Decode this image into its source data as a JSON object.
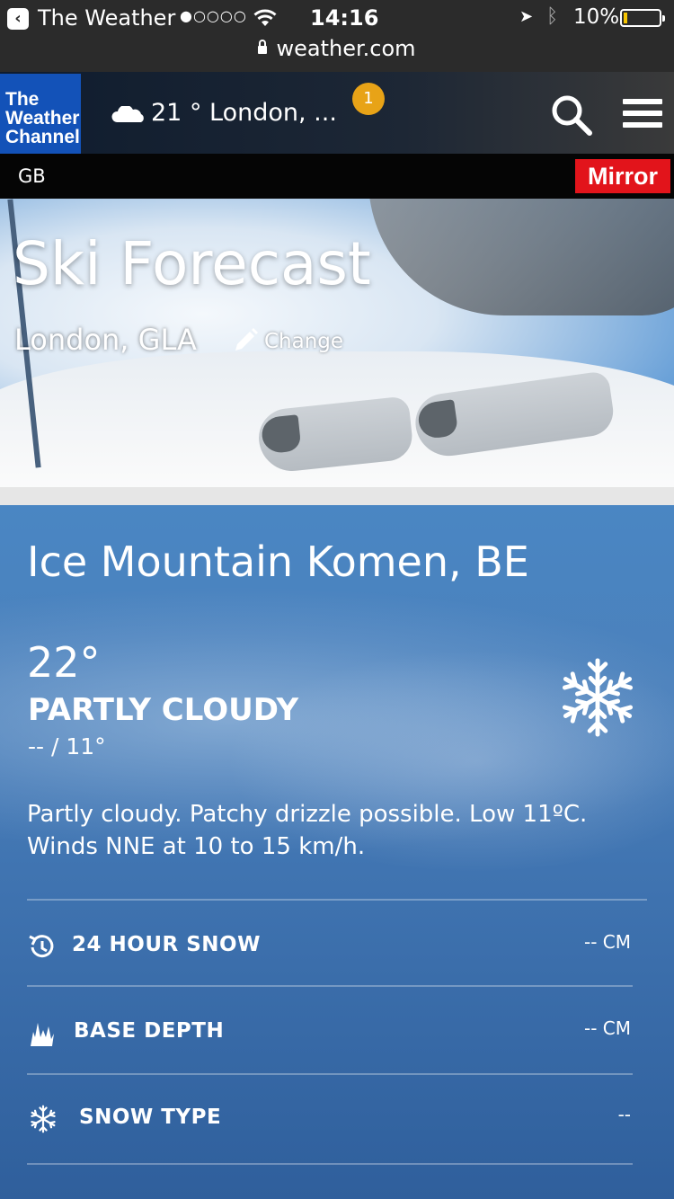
{
  "status_bar": {
    "back_app": "The Weather",
    "signal": "●○○○○",
    "time": "14:16",
    "battery": "10%",
    "url": "weather.com"
  },
  "header": {
    "logo_lines": [
      "The",
      "Weather",
      "Channel"
    ],
    "current_temp_location": "21 ° London, ...",
    "notification_count": "1",
    "icons": [
      "cloud-icon",
      "search-icon",
      "menu-icon"
    ]
  },
  "subbar": {
    "region": "GB",
    "partner": "Mirror"
  },
  "hero": {
    "title": "Ski Forecast",
    "location": "London, GLA",
    "change_label": "Change"
  },
  "resort": {
    "name": "Ice Mountain Komen, BE",
    "temperature": "22°",
    "condition": "PARTLY CLOUDY",
    "hi_lo": "-- / 11°",
    "description": "Partly cloudy. Patchy drizzle possible. Low 11ºC. Winds NNE at 10 to 15 km/h.",
    "stats": [
      {
        "icon": "history-icon",
        "label": "24 HOUR SNOW",
        "value": "-- CM"
      },
      {
        "icon": "mountain-icon",
        "label": "BASE DEPTH",
        "value": "-- CM"
      },
      {
        "icon": "snowflake-icon",
        "label": "SNOW TYPE",
        "value": "--"
      }
    ]
  },
  "colors": {
    "logo_blue": "#1352b8",
    "badge": "#e8a317",
    "mirror_red": "#e2141b",
    "card_blue": "#4a86c3"
  }
}
